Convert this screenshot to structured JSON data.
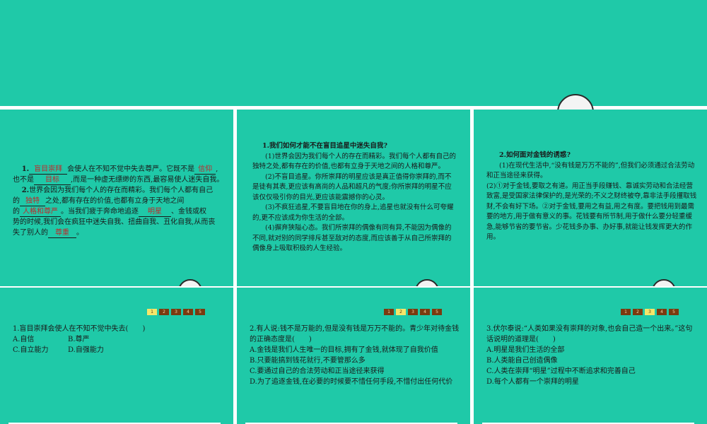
{
  "slide1": {
    "q1_num": "1.",
    "q1_b1": "盲目崇拜",
    "q1_t1": "会使人在不知不觉中失去尊严。它既不是",
    "q1_b2": "信仰",
    "q1_t2": ",",
    "q1_t3": "也不是",
    "q1_b3": "目标",
    "q1_t4": ",而是一种虚无缥缈的东西,最容易使人迷失自我。",
    "q2_num": "2.",
    "q2_t1": "世界会因为我们每个人的存在而精彩。我们每个人都有自己",
    "q2_t2": "的",
    "q2_b1": "独特",
    "q2_t3": "之处,都有存在的价值,也都有立身于天地之间",
    "q2_t4": "的",
    "q2_b2": "人格和尊严",
    "q2_t5": "。当我们疲于奔命地追逐",
    "q2_b3": "明星",
    "q2_t6": "、金钱或权",
    "q2_t7": "势的时候,我们会在疯狂中迷失自我、扭曲自我、丑化自我,从而丧",
    "q2_t8": "失了别人的",
    "q2_b4": "尊重",
    "q2_t9": "。"
  },
  "slide2": {
    "title": "1.我们如何才能不在盲目追星中迷失自我?",
    "p1": "(1)世界会因为我们每个人的存在而精彩。我们每个人都有自己的独特之处,都有存在的价值,也都有立身于天地之间的人格和尊严。",
    "p2": "(2)不盲目追星。你所崇拜的明星应该是真正值得你崇拜的,而不是徒有其表,更应该有高尚的人品和超凡的气度;你所崇拜的明星不应该仅仅吸引你的目光,更应该能震撼你的心灵。",
    "p3": "(3)不疯狂追星,不要盲目地在你的身上,追星也就没有什么可夸耀的,更不应该成为你生活的全部。",
    "p4": "(4)摒弃狭隘心态。我们所崇拜的偶像有同有异,不能因为偶像的不同,就对别的同学排斥甚至敌对的态度,而应该善于从自己所崇拜的偶像身上吸取积极的人生经验。"
  },
  "slide3": {
    "title": "2.如何面对金钱的诱惑?",
    "p1": "(1)在现代生活中,“没有钱是万万不能的”,但我们必须通过合法劳动和正当途径来获得。",
    "p2": "(2)①对于金钱,要取之有道。用正当手段赚钱、靠诚实劳动和合法经营致富,是受国家法律保护的,是光荣的;不义之财终被夺,靠非法手段攫取钱财,不会有好下场。②对于金钱,要用之有益,用之有度。要把钱用到最需要的地方,用于做有意义的事。花钱要有所节制,用于做什么要分轻重缓急,能够节省的要节省。少花钱多办事、办好事,就能让钱发挥更大的作用。"
  },
  "pager": [
    "1",
    "2",
    "3",
    "4",
    "5"
  ],
  "slide4": {
    "q": "1.盲目崇拜会使人在不知不觉中失去(　　)",
    "a": "A.自信",
    "b": "B.尊严",
    "c": "C.自立能力",
    "d": "D.自强能力"
  },
  "slide5": {
    "q": "2.有人说:钱不是万能的,但是没有钱是万万不能的。青少年对待金钱的正确态度是(　　)",
    "a": "A.金钱是我们人生唯一的目标,拥有了金钱,就体现了自我价值",
    "b": "B.只要能搞到钱花就行,不要管那么多",
    "c": "C.要通过自己的合法劳动和正当途径来获得",
    "d": "D.为了追逐金钱,在必要的时候要不惜任何手段,不惜付出任何代价"
  },
  "slide6": {
    "q": "3.伏尔泰说:“人类如果没有崇拜的对象,也会自己造一个出来。”这句话说明的道理是(　　)",
    "a": "A.明星是我们生活的全部",
    "b": "B.人类能自己创造偶像",
    "c": "C.人类在崇拜“明星”过程中不断追求和完善自己",
    "d": "D.每个人都有一个崇拜的明星"
  }
}
